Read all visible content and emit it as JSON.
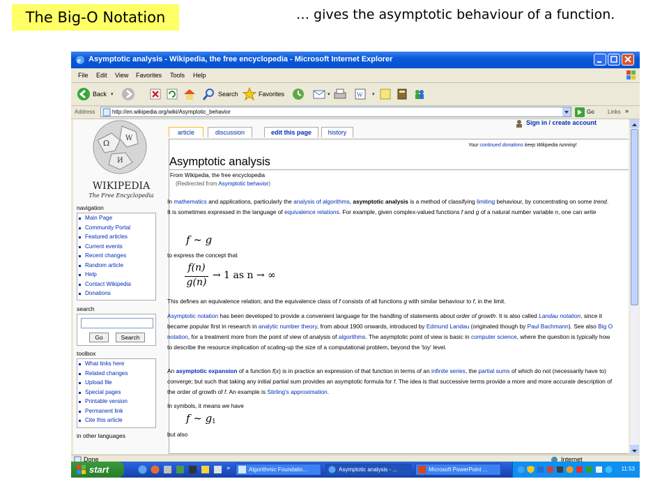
{
  "slide": {
    "title": "The Big-O Notation",
    "subtitle": "… gives the asymptotic behaviour of a function."
  },
  "browser": {
    "window_title": "Asymptotic analysis - Wikipedia, the free encyclopedia - Microsoft Internet Explorer",
    "menu": [
      "File",
      "Edit",
      "View",
      "Favorites",
      "Tools",
      "Help"
    ],
    "toolbar": {
      "back": "Back",
      "search": "Search",
      "favorites": "Favorites"
    },
    "address_label": "Address",
    "url": "http://en.wikipedia.org/wiki/Asymptotic_behavior",
    "go": "Go",
    "links": "Links",
    "status": "Done",
    "zone": "Internet"
  },
  "wiki": {
    "logo_word": "WIKIPEDIA",
    "logo_tagline": "The Free Encyclopedia",
    "user_link": "Sign in / create account",
    "tabs": [
      "article",
      "discussion",
      "edit this page",
      "history"
    ],
    "donation_prefix": "Your ",
    "donation_link": "continued donations",
    "donation_suffix": " keep Wikipedia running!",
    "heading": "Asymptotic analysis",
    "from": "From Wikipedia, the free encyclopedia",
    "redirect_prefix": "(Redirected from ",
    "redirect_link": "Asymptotic behavior",
    "redirect_suffix": ")",
    "navigation_title": "navigation",
    "navigation": [
      "Main Page",
      "Community Portal",
      "Featured articles",
      "Current events",
      "Recent changes",
      "Random article",
      "Help",
      "Contact Wikipedia",
      "Donations"
    ],
    "search_title": "search",
    "search_go": "Go",
    "search_button": "Search",
    "toolbox_title": "toolbox",
    "toolbox": [
      "What links here",
      "Related changes",
      "Upload file",
      "Special pages",
      "Printable version",
      "Permanent link",
      "Cite this article"
    ],
    "other_languages_title": "in other languages",
    "p1": [
      {
        "t": "In "
      },
      {
        "t": "mathematics",
        "link": true
      },
      {
        "t": " and applications, particularly the "
      },
      {
        "t": "analysis of algorithms",
        "link": true
      },
      {
        "t": ", "
      },
      {
        "t": "asymptotic analysis",
        "bold": true
      },
      {
        "t": " is a method of classifying "
      },
      {
        "t": "limiting",
        "link": true
      },
      {
        "t": " behaviour, by concentrating on some "
      },
      {
        "t": "trend",
        "italic": true
      },
      {
        "t": ". It is sometimes expressed in the language of "
      },
      {
        "t": "equivalence relations",
        "link": true
      },
      {
        "t": ". For example, given complex-valued functions "
      },
      {
        "t": "f",
        "italic": true
      },
      {
        "t": " and "
      },
      {
        "t": "g",
        "italic": true
      },
      {
        "t": " of a natural number variable "
      },
      {
        "t": "n",
        "italic": true
      },
      {
        "t": ", one can write"
      }
    ],
    "math1": "f ∼ g",
    "p2": "to express the concept that",
    "math2_num": "f(n)",
    "math2_den": "g(n)",
    "math2_rest": "→ 1 as n → ∞",
    "p3": [
      {
        "t": "This defines an equivalence relation; and the equivalence class of "
      },
      {
        "t": "f",
        "italic": true
      },
      {
        "t": " consists of all functions "
      },
      {
        "t": "g",
        "italic": true
      },
      {
        "t": " with similar behaviour to "
      },
      {
        "t": "f",
        "italic": true
      },
      {
        "t": ", in the limit."
      }
    ],
    "p4": [
      {
        "t": "Asymptotic notation",
        "link": true
      },
      {
        "t": " has been developed to provide a convenient language for the handling of statements about "
      },
      {
        "t": "order of growth",
        "italic": true
      },
      {
        "t": ". It is also called "
      },
      {
        "t": "Landau notation",
        "link": true,
        "italic": true
      },
      {
        "t": ", since it became popular first in research in "
      },
      {
        "t": "analytic number theory",
        "link": true
      },
      {
        "t": ", from about 1900 onwards, introduced by "
      },
      {
        "t": "Edmund Landau",
        "link": true
      },
      {
        "t": " (originated though by "
      },
      {
        "t": "Paul Bachmann",
        "link": true
      },
      {
        "t": "). See also "
      },
      {
        "t": "Big O notation",
        "link": true
      },
      {
        "t": ", for a treatment more from the point of view of analysis of "
      },
      {
        "t": "algorithms",
        "link": true
      },
      {
        "t": ". The asymptotic point of view is basic in "
      },
      {
        "t": "computer science",
        "link": true
      },
      {
        "t": ", where the question is typically how to describe the resource implication of scaling-up the size of a computational problem, beyond the 'toy' level."
      }
    ],
    "p5": [
      {
        "t": "An "
      },
      {
        "t": "asymptotic expansion",
        "link": true,
        "bold": true
      },
      {
        "t": " of a function "
      },
      {
        "t": "f",
        "italic": true
      },
      {
        "t": "("
      },
      {
        "t": "x",
        "italic": true
      },
      {
        "t": ") is in practice an expression of that function in terms of an "
      },
      {
        "t": "infinite series",
        "link": true
      },
      {
        "t": ", the "
      },
      {
        "t": "partial sums",
        "link": true
      },
      {
        "t": " of which do not (necessarily have to) converge; but such that taking any initial partial sum provides an asymptotic formula for "
      },
      {
        "t": "f",
        "italic": true
      },
      {
        "t": ". The idea is that successive terms provide a more and more accurate description of the order of growth of "
      },
      {
        "t": "f",
        "italic": true
      },
      {
        "t": ". An example is "
      },
      {
        "t": "Stirling's approximation",
        "link": true
      },
      {
        "t": "."
      }
    ],
    "p6": "In symbols, it means we have",
    "math3": "f ∼ g",
    "math3_sub": "1",
    "p7": "but also"
  },
  "taskbar": {
    "start": "start",
    "tasks": [
      "Algorithmic Foundatio...",
      "Asymptotic analysis - ...",
      "Microsoft PowerPoint ..."
    ],
    "clock": "11:53"
  }
}
